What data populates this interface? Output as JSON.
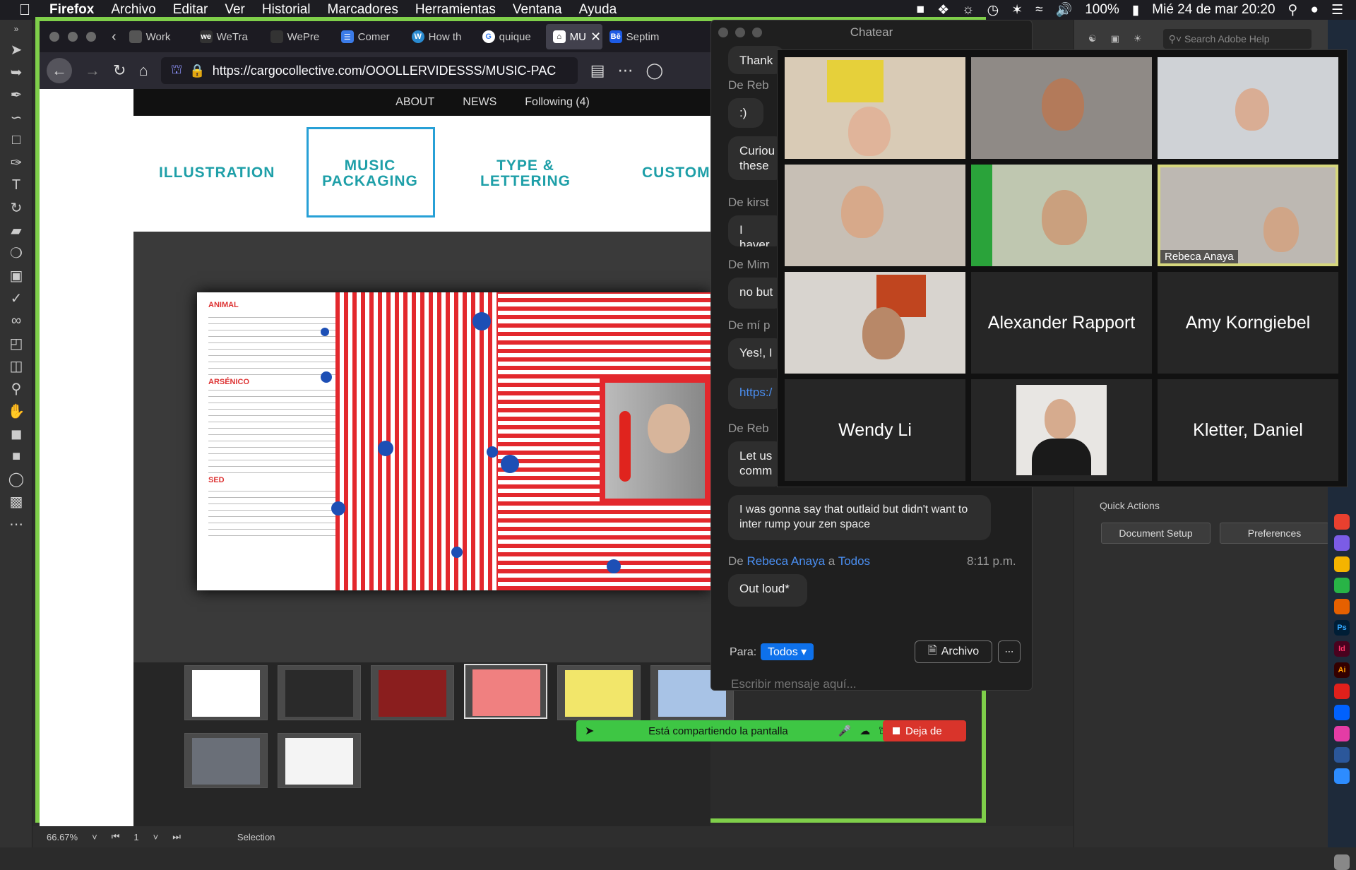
{
  "menubar": {
    "app": "Firefox",
    "items": [
      "Archivo",
      "Editar",
      "Ver",
      "Historial",
      "Marcadores",
      "Herramientas",
      "Ventana",
      "Ayuda"
    ],
    "battery": "100%",
    "clock": "Mié 24 de mar  20:20"
  },
  "firefox": {
    "tabs": [
      {
        "label": "Work",
        "icon": "page-icon",
        "color": "#555"
      },
      {
        "label": "WeTra",
        "icon": "wetransfer-icon",
        "color": "#333"
      },
      {
        "label": "WePre",
        "icon": "wepresent-icon",
        "color": "#333"
      },
      {
        "label": "Comer",
        "icon": "google-docs-icon",
        "color": "#3b7be8"
      },
      {
        "label": "How th",
        "icon": "wordpress-icon",
        "color": "#2a8bd1"
      },
      {
        "label": "quique",
        "icon": "google-icon",
        "color": "#fff"
      },
      {
        "label": "MU",
        "icon": "cargo-icon",
        "color": "#fff",
        "active": true
      },
      {
        "label": "Septim",
        "icon": "behance-icon",
        "color": "#1d5be5"
      }
    ],
    "url": "https://cargocollective.com/OOOLLERVIDESSS/MUSIC-PAC"
  },
  "site": {
    "nav": [
      "ABOUT",
      "NEWS",
      "Following (4)"
    ],
    "categories": [
      "ILLUSTRATION",
      "MUSIC PACKAGING",
      "TYPE & LETTERING",
      "CUSTOM"
    ],
    "album_headings": [
      "ANIMAL",
      "ARSÉNICO",
      "SED"
    ]
  },
  "share": {
    "status": "Está compartiendo la pantalla",
    "stop": "Deja de"
  },
  "chat": {
    "title": "Chatear",
    "messages": [
      {
        "from": "",
        "text": "Thank"
      },
      {
        "from": "De Reb",
        "text": ":)"
      },
      {
        "from": "",
        "text": "Curiou these"
      },
      {
        "from": "De kirst",
        "text": "I haver"
      },
      {
        "from": "De Mim",
        "text": "no but"
      },
      {
        "from": "De mí p",
        "text": "Yes!, I"
      },
      {
        "from": "",
        "text": "https:/"
      },
      {
        "from": "De Reb",
        "text": "Let us comm"
      },
      {
        "from": "",
        "text": "I was gonna say that outlaid but didn't want to inter rump your zen space"
      }
    ],
    "last": {
      "prefix": "De",
      "sender": "Rebeca Anaya",
      "mid": "a",
      "to": "Todos",
      "time": "8:11 p.m.",
      "text": "Out loud*"
    },
    "para_label": "Para:",
    "recipient": "Todos",
    "file_button": "Archivo",
    "placeholder": "Escribir mensaje aquí..."
  },
  "gallery": {
    "tiles": [
      {
        "name": "",
        "video": true
      },
      {
        "name": "",
        "video": true
      },
      {
        "name": "",
        "video": true
      },
      {
        "name": "",
        "video": true
      },
      {
        "name": "",
        "video": true
      },
      {
        "name": "Rebeca Anaya",
        "video": true,
        "speaking": true
      },
      {
        "name": "",
        "video": true
      },
      {
        "name": "Alexander Rapport",
        "video": false
      },
      {
        "name": "Amy Korngiebel",
        "video": false
      },
      {
        "name": "Wendy Li",
        "video": false
      },
      {
        "name": "",
        "video": true,
        "photo": true
      },
      {
        "name": "Kletter, Daniel",
        "video": false
      }
    ]
  },
  "illustrator": {
    "search_placeholder": "Search Adobe Help",
    "quick_actions": "Quick Actions",
    "document_setup": "Document Setup",
    "preferences": "Preferences",
    "zoom": "66.67%",
    "artboard": "1",
    "tool": "Selection"
  },
  "colors": {
    "accent": "#0e71eb",
    "share_green": "#3ec644",
    "stop_red": "#d9342b",
    "window_green": "#7fcf4a",
    "teal": "#1e9fa8"
  }
}
